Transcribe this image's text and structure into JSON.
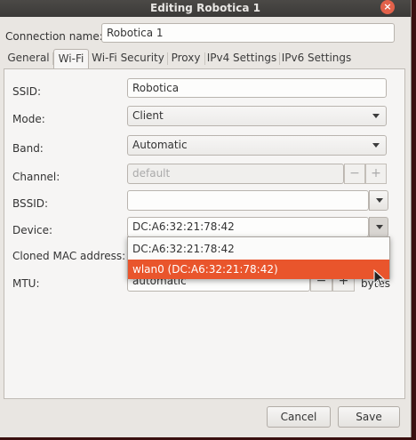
{
  "window": {
    "title": "Editing Robotica 1",
    "close_glyph": "×"
  },
  "connection": {
    "label": "Connection name:",
    "value": "Robotica 1"
  },
  "tabs": [
    {
      "label": "General",
      "active": false
    },
    {
      "label": "Wi-Fi",
      "active": true
    },
    {
      "label": "Wi-Fi Security",
      "active": false
    },
    {
      "label": "Proxy",
      "active": false
    },
    {
      "label": "IPv4 Settings",
      "active": false
    },
    {
      "label": "IPv6 Settings",
      "active": false
    }
  ],
  "form": {
    "ssid": {
      "label": "SSID:",
      "value": "Robotica"
    },
    "mode": {
      "label": "Mode:",
      "value": "Client"
    },
    "band": {
      "label": "Band:",
      "value": "Automatic"
    },
    "channel": {
      "label": "Channel:",
      "placeholder": "default",
      "minus": "−",
      "plus": "+"
    },
    "bssid": {
      "label": "BSSID:",
      "value": ""
    },
    "device": {
      "label": "Device:",
      "value": "DC:A6:32:21:78:42"
    },
    "cloned_mac": {
      "label": "Cloned MAC address:"
    },
    "mtu": {
      "label": "MTU:",
      "value": "automatic",
      "minus": "−",
      "plus": "+",
      "unit": "bytes"
    }
  },
  "device_dropdown": {
    "options": [
      "DC:A6:32:21:78:42",
      "wlan0 (DC:A6:32:21:78:42)"
    ],
    "highlighted_index": 1
  },
  "buttons": {
    "cancel": "Cancel",
    "save": "Save"
  },
  "colors": {
    "highlight": "#e9552c",
    "titlebar": "#3b3a38",
    "background": "#f6f5f4"
  }
}
